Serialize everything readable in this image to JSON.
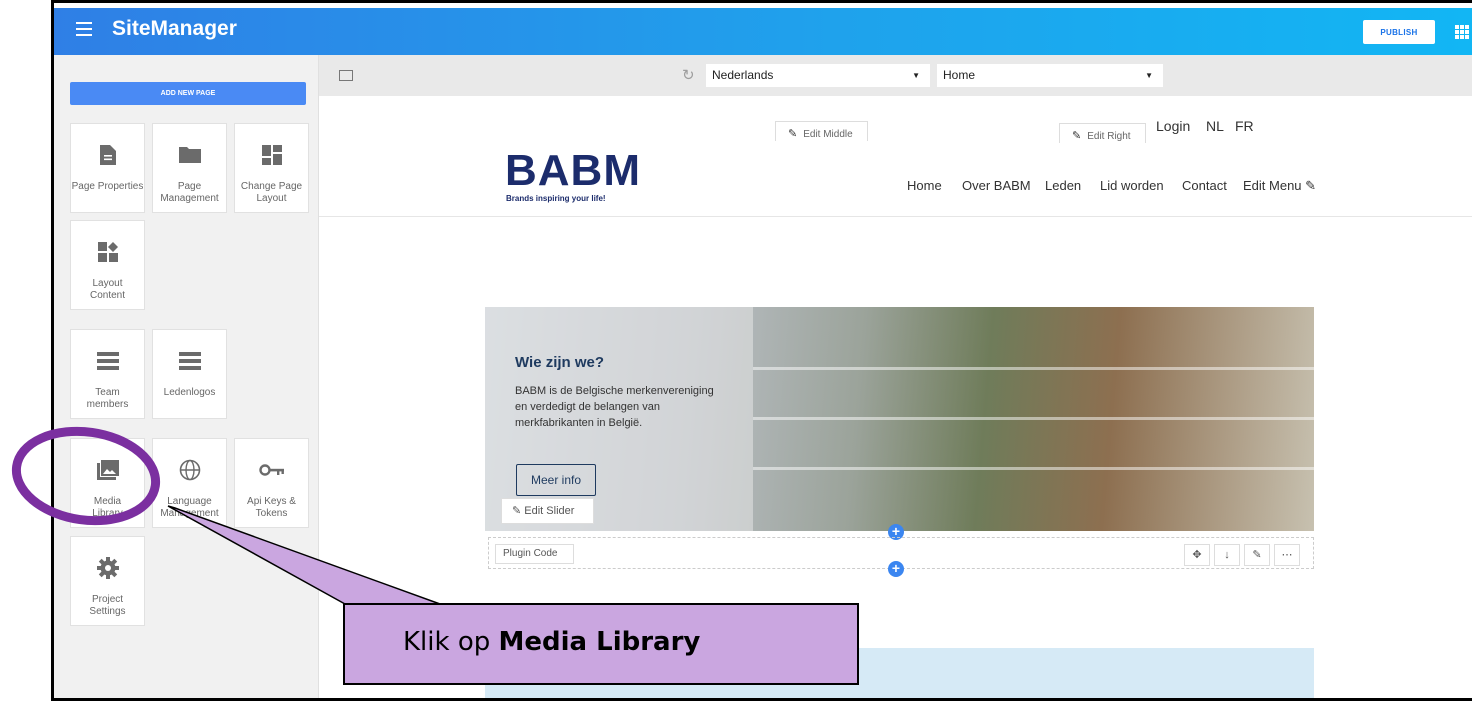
{
  "app": {
    "brand": "SiteManager",
    "publish_label": "PUBLISH"
  },
  "sidebar": {
    "add_page_label": "ADD NEW PAGE",
    "tiles": [
      {
        "label": "Page Properties",
        "icon": "page-icon"
      },
      {
        "label": "Page Management",
        "icon": "folder-icon"
      },
      {
        "label": "Change Page Layout",
        "icon": "layout-grid-icon"
      },
      {
        "label": "Layout Content",
        "icon": "layout-content-icon"
      },
      {
        "label": "Team members",
        "icon": "list-icon"
      },
      {
        "label": "Ledenlogos",
        "icon": "list-icon"
      },
      {
        "label": "Media Library",
        "icon": "photo-library-icon"
      },
      {
        "label": "Language Management",
        "icon": "globe-icon"
      },
      {
        "label": "Api Keys & Tokens",
        "icon": "key-icon"
      },
      {
        "label": "Project Settings",
        "icon": "gear-icon"
      }
    ]
  },
  "toolbar": {
    "language": "Nederlands",
    "page": "Home"
  },
  "site": {
    "edit_middle": "Edit Middle",
    "edit_right": "Edit Right",
    "login": "Login",
    "lang_nl": "NL",
    "lang_fr": "FR",
    "logo": "BABM",
    "tagline": "Brands inspiring your life!",
    "nav": [
      "Home",
      "Over BABM",
      "Leden",
      "Lid worden",
      "Contact",
      "Edit Menu"
    ],
    "slider": {
      "heading": "Wie zijn we?",
      "text": "BABM is de Belgische merkenvereniging en verdedigt de belangen van merkfabrikanten in België.",
      "button": "Meer info",
      "edit_label": "Edit Slider"
    },
    "plugin_code": "Plugin Code"
  },
  "callout": {
    "prefix": "Klik op ",
    "bold": "Media Library"
  },
  "colors": {
    "topbar": "#2a8de8",
    "accent": "#4a8af4",
    "callout": "#caa6e0",
    "highlight_ring": "#7b2fa0",
    "logo": "#1c2c6c"
  }
}
